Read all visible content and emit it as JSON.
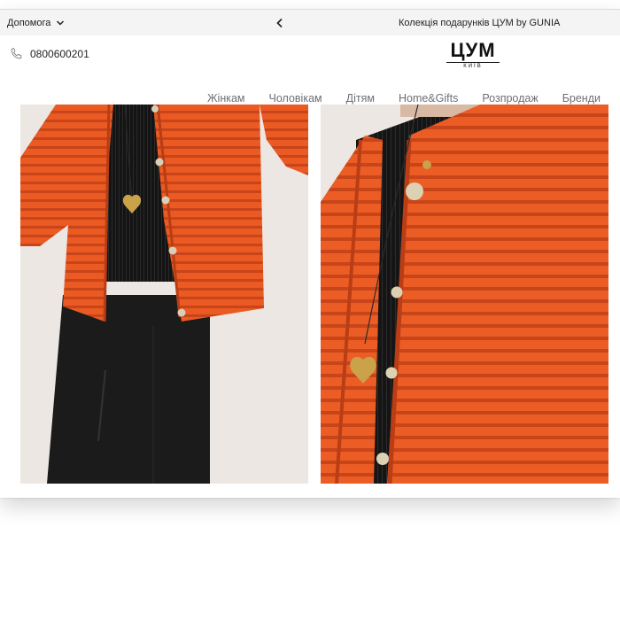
{
  "topbar": {
    "help_label": "Допомога",
    "promo_text": "Колекція подарунків ЦУМ by GUNIA"
  },
  "header": {
    "phone": "0800600201",
    "logo_main": "ЦУМ",
    "logo_sub": "КИЇВ"
  },
  "nav": {
    "items": [
      "Жінкам",
      "Чоловікам",
      "Дітям",
      "Home&Gifts",
      "Розпродаж",
      "Бренди"
    ]
  },
  "gallery": {
    "images": [
      {
        "subject": "orange ribbed knit cardigan with gold buttons, black denim skirt"
      },
      {
        "subject": "close-up orange knit cardigan with gold heart pendant"
      }
    ]
  },
  "colors": {
    "cardigan": "#ea5a22",
    "topbar_bg": "#f4f4f4",
    "nav_text": "#6c6f78"
  }
}
